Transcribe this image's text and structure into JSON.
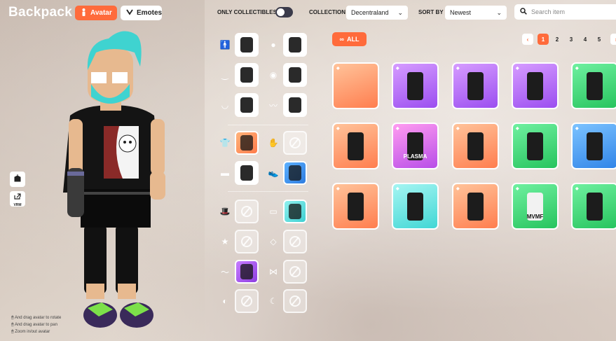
{
  "header": {
    "title": "Backpack",
    "tabs": [
      {
        "label": "Avatar",
        "active": true
      },
      {
        "label": "Emotes",
        "active": false
      }
    ],
    "only_collectibles_label": "ONLY COLLECTIBLES",
    "collection_label": "COLLECTION",
    "collection_value": "Decentraland",
    "sort_label": "SORT BY",
    "sort_value": "Newest",
    "search_placeholder": "Search item"
  },
  "side_buttons": {
    "vrm_label": "VRM"
  },
  "hints": [
    "And drag avatar to rotate",
    "And drag avatar to pan",
    "Zoom in/out avatar"
  ],
  "slots": [
    {
      "category": "body-shape",
      "state": "filled"
    },
    {
      "category": "hair",
      "state": "filled"
    },
    {
      "category": "eyebrows",
      "state": "filled"
    },
    {
      "category": "eyes",
      "state": "filled"
    },
    {
      "category": "mouth",
      "state": "filled"
    },
    {
      "category": "facial-hair",
      "state": "filled"
    },
    {
      "category": "upper-body",
      "state": "orange"
    },
    {
      "category": "hands",
      "state": "empty"
    },
    {
      "category": "lower-body",
      "state": "filled"
    },
    {
      "category": "feet",
      "state": "blue"
    },
    {
      "category": "hat",
      "state": "empty"
    },
    {
      "category": "eyewear",
      "state": "cyan"
    },
    {
      "category": "tiara",
      "state": "empty"
    },
    {
      "category": "mask",
      "state": "empty"
    },
    {
      "category": "hands-wear",
      "state": "purple"
    },
    {
      "category": "top-head",
      "state": "empty"
    },
    {
      "category": "earring",
      "state": "empty"
    },
    {
      "category": "helmet",
      "state": "empty"
    }
  ],
  "filter": {
    "all_label": "ALL"
  },
  "pagination": {
    "pages": [
      "1",
      "2",
      "3",
      "4",
      "5"
    ],
    "current": "1"
  },
  "items": [
    {
      "rarity": "orange"
    },
    {
      "rarity": "purple"
    },
    {
      "rarity": "purple"
    },
    {
      "rarity": "purple"
    },
    {
      "rarity": "green"
    },
    {
      "rarity": "orange"
    },
    {
      "rarity": "pink",
      "label": "PLASMA"
    },
    {
      "rarity": "orange"
    },
    {
      "rarity": "green"
    },
    {
      "rarity": "blue"
    },
    {
      "rarity": "orange"
    },
    {
      "rarity": "cyan"
    },
    {
      "rarity": "orange"
    },
    {
      "rarity": "green",
      "label": "MVMF"
    },
    {
      "rarity": "green"
    }
  ]
}
